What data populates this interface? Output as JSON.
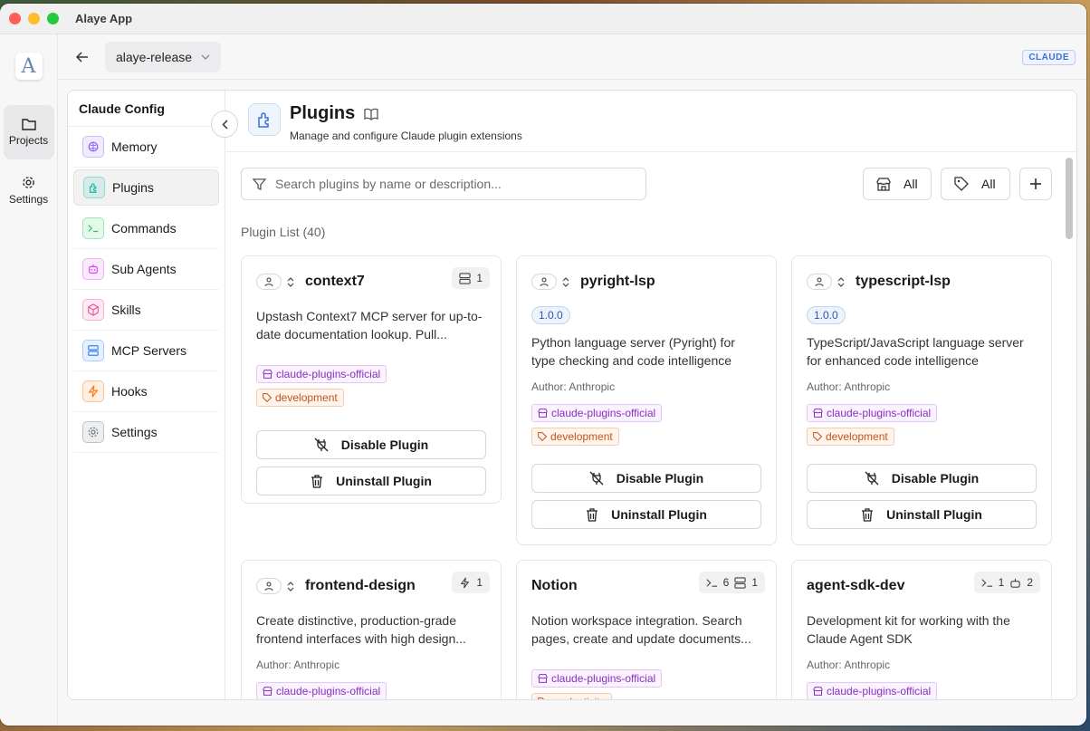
{
  "window": {
    "title": "Alaye App",
    "traffic": {
      "close": "#ff5f57",
      "min": "#febc2e",
      "max": "#28c840"
    }
  },
  "rail": {
    "logo": "A",
    "items": [
      {
        "label": "Projects",
        "icon": "folder-icon"
      },
      {
        "label": "Settings",
        "icon": "gear-icon"
      }
    ]
  },
  "topbar": {
    "project": "alaye-release",
    "badge": "CLAUDE"
  },
  "sidebar": {
    "title": "Claude Config",
    "items": [
      {
        "label": "Memory",
        "icon": "brain-icon",
        "color": "#8b5cf6"
      },
      {
        "label": "Plugins",
        "icon": "puzzle-icon",
        "color": "#14b8a6"
      },
      {
        "label": "Commands",
        "icon": "terminal-icon",
        "color": "#22c55e"
      },
      {
        "label": "Sub Agents",
        "icon": "bot-icon",
        "color": "#d946ef"
      },
      {
        "label": "Skills",
        "icon": "cube-icon",
        "color": "#ec4899"
      },
      {
        "label": "MCP Servers",
        "icon": "server-icon",
        "color": "#3b82f6"
      },
      {
        "label": "Hooks",
        "icon": "bolt-icon",
        "color": "#f97316"
      },
      {
        "label": "Settings",
        "icon": "gear-icon",
        "color": "#6b7280"
      }
    ]
  },
  "header": {
    "title": "Plugins",
    "subtitle": "Manage and configure Claude plugin extensions"
  },
  "toolbar": {
    "search_placeholder": "Search plugins by name or description...",
    "marketplace_filter": "All",
    "category_filter": "All"
  },
  "list": {
    "label": "Plugin List (40)"
  },
  "plugins": [
    {
      "name": "context7",
      "version": "",
      "desc": "Upstash Context7 MCP server for up-to-date documentation lookup. Pull...",
      "author_label": "",
      "author": "",
      "counts": [
        "1"
      ],
      "tags": [
        "claude-plugins-official",
        "development"
      ],
      "disable": "Disable Plugin",
      "uninstall": "Uninstall Plugin"
    },
    {
      "name": "pyright-lsp",
      "version": "1.0.0",
      "desc": "Python language server (Pyright) for type checking and code intelligence",
      "author_label": "Author:",
      "author": "Anthropic",
      "counts": [],
      "tags": [
        "claude-plugins-official",
        "development"
      ],
      "disable": "Disable Plugin",
      "uninstall": "Uninstall Plugin"
    },
    {
      "name": "typescript-lsp",
      "version": "1.0.0",
      "desc": "TypeScript/JavaScript language server for enhanced code intelligence",
      "author_label": "Author:",
      "author": "Anthropic",
      "counts": [],
      "tags": [
        "claude-plugins-official",
        "development"
      ],
      "disable": "Disable Plugin",
      "uninstall": "Uninstall Plugin"
    },
    {
      "name": "frontend-design",
      "version": "",
      "desc": "Create distinctive, production-grade frontend interfaces with high design...",
      "author_label": "Author:",
      "author": "Anthropic",
      "counts": [
        "1"
      ],
      "tags": [
        "claude-plugins-official"
      ]
    },
    {
      "name": "Notion",
      "version": "",
      "desc": "Notion workspace integration. Search pages, create and update documents...",
      "author_label": "",
      "author": "",
      "counts": [
        "6",
        "1"
      ],
      "tags": [
        "claude-plugins-official",
        "productivity"
      ]
    },
    {
      "name": "agent-sdk-dev",
      "version": "",
      "desc": "Development kit for working with the Claude Agent SDK",
      "author_label": "Author:",
      "author": "Anthropic",
      "counts": [
        "1",
        "2"
      ],
      "tags": [
        "claude-plugins-official"
      ]
    }
  ]
}
